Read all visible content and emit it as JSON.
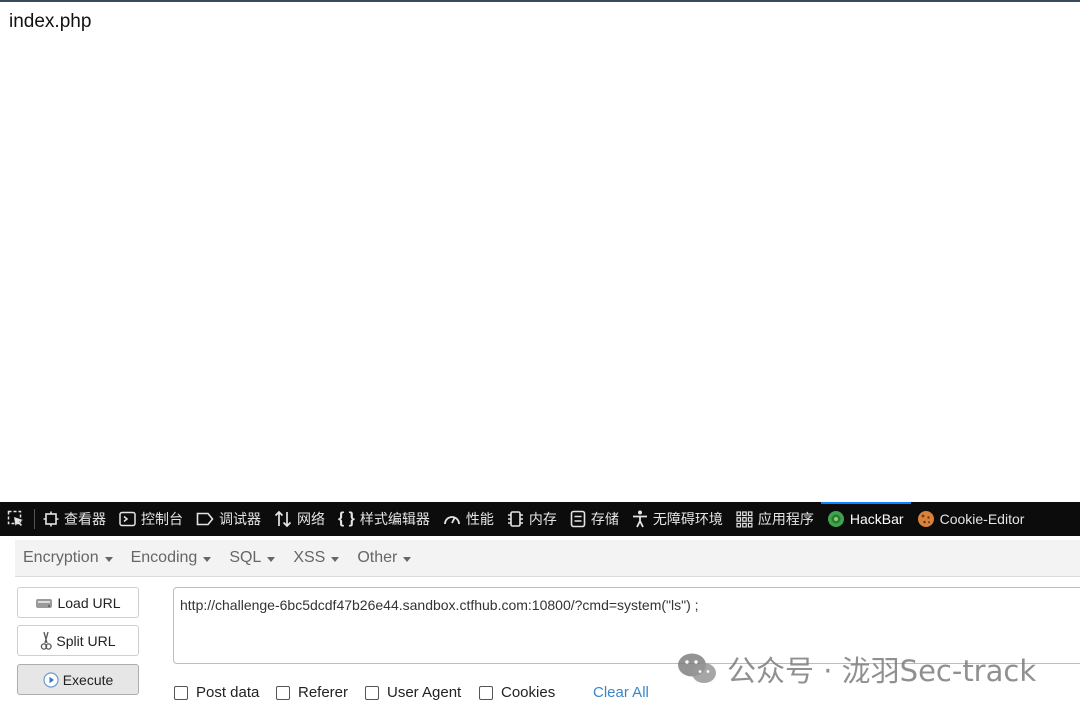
{
  "page": {
    "filename": "index.php"
  },
  "devtools": {
    "tabs": [
      {
        "label": "查看器",
        "icon": "inspector-icon"
      },
      {
        "label": "控制台",
        "icon": "console-icon"
      },
      {
        "label": "调试器",
        "icon": "debugger-icon"
      },
      {
        "label": "网络",
        "icon": "network-icon"
      },
      {
        "label": "样式编辑器",
        "icon": "style-editor-icon"
      },
      {
        "label": "性能",
        "icon": "performance-icon"
      },
      {
        "label": "内存",
        "icon": "memory-icon"
      },
      {
        "label": "存储",
        "icon": "storage-icon"
      },
      {
        "label": "无障碍环境",
        "icon": "accessibility-icon"
      },
      {
        "label": "应用程序",
        "icon": "application-icon"
      },
      {
        "label": "HackBar",
        "icon": "hackbar-icon",
        "active": true
      },
      {
        "label": "Cookie-Editor",
        "icon": "cookie-icon"
      }
    ]
  },
  "hackbar": {
    "menus": [
      "Encryption",
      "Encoding",
      "SQL",
      "XSS",
      "Other"
    ],
    "buttons": {
      "load": "Load URL",
      "split": "Split URL",
      "execute": "Execute"
    },
    "url": "http://challenge-6bc5dcdf47b26e44.sandbox.ctfhub.com:10800/?cmd=system(\"ls\") ;",
    "options": {
      "post_data": "Post data",
      "referer": "Referer",
      "user_agent": "User Agent",
      "cookies": "Cookies"
    },
    "clear_all": "Clear All"
  },
  "watermark": {
    "text": "公众号 · 泷羽Sec-track"
  },
  "colors": {
    "toolbar_bg": "#0c0c0d",
    "active_tab_accent": "#0a84ff",
    "link": "#3a87c8",
    "hackbar_icon": "#3fa34d",
    "cookie_icon": "#d9823b"
  }
}
